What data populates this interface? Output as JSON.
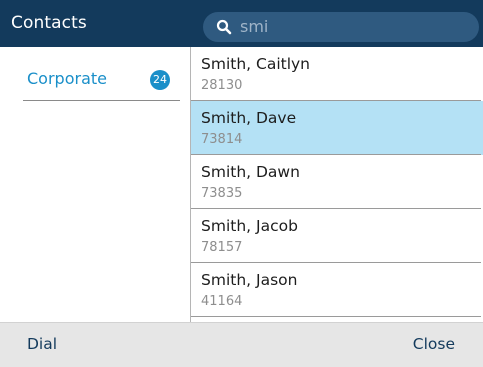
{
  "header": {
    "title": "Contacts",
    "search_value": "smi"
  },
  "sidebar": {
    "category": {
      "label": "Corporate",
      "count": "24"
    }
  },
  "contacts": [
    {
      "name": "Smith, Caitlyn",
      "number": "28130",
      "selected": false
    },
    {
      "name": "Smith, Dave",
      "number": "73814",
      "selected": true
    },
    {
      "name": "Smith, Dawn",
      "number": "73835",
      "selected": false
    },
    {
      "name": "Smith, Jacob",
      "number": "78157",
      "selected": false
    },
    {
      "name": "Smith, Jason",
      "number": "41164",
      "selected": false
    }
  ],
  "softkeys": {
    "left": "Dial",
    "right": "Close"
  },
  "colors": {
    "header_bg": "#133a5c",
    "accent": "#1a8fc9",
    "selected_row": "#b4e1f5",
    "footer_bg": "#e6e6e6"
  },
  "icons": {
    "search": "search-icon"
  }
}
